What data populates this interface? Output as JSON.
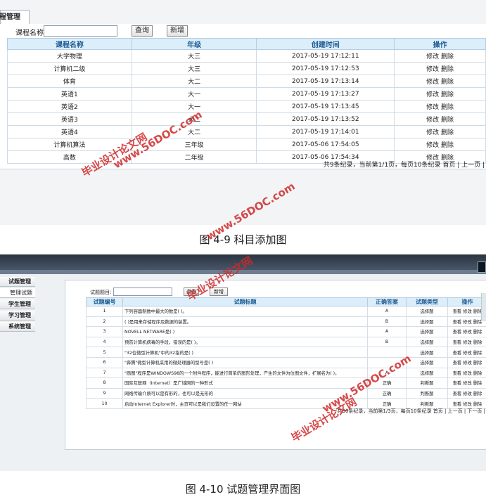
{
  "figure1": {
    "tab_label": "程管理",
    "search_label": "课程名称:",
    "search_value": "",
    "query_button": "查询",
    "add_button": "新增",
    "columns": [
      "课程名称",
      "年级",
      "创建时间",
      "操作"
    ],
    "rows": [
      {
        "name": "大学物理",
        "grade": "大三",
        "created": "2017-05-19 17:12:11"
      },
      {
        "name": "计算机二级",
        "grade": "大三",
        "created": "2017-05-19 17:12:53"
      },
      {
        "name": "体育",
        "grade": "大二",
        "created": "2017-05-19 17:13:14"
      },
      {
        "name": "英语1",
        "grade": "大一",
        "created": "2017-05-19 17:13:27"
      },
      {
        "name": "英语2",
        "grade": "大一",
        "created": "2017-05-19 17:13:45"
      },
      {
        "name": "英语3",
        "grade": "大二",
        "created": "2017-05-19 17:13:52"
      },
      {
        "name": "英语4",
        "grade": "大二",
        "created": "2017-05-19 17:14:01"
      },
      {
        "name": "计算机算法",
        "grade": "三年级",
        "created": "2017-05-06 17:54:05"
      },
      {
        "name": "高数",
        "grade": "二年级",
        "created": "2017-05-06 17:54:34"
      }
    ],
    "edit_label": "修改",
    "delete_label": "删除",
    "pager": "共9条纪录，当前第1/1页，每页10条纪录 首页 | 上一页 |"
  },
  "caption1": "图 4-9 科目添加图",
  "figure2": {
    "sidebar": [
      {
        "label": "试题管理",
        "sub": false
      },
      {
        "label": "管理试题",
        "sub": true
      },
      {
        "label": "学生管理",
        "sub": false
      },
      {
        "label": "学习管理",
        "sub": false
      },
      {
        "label": "系统管理",
        "sub": false
      }
    ],
    "tab_label": "试题管理",
    "search_label": "试题题目:",
    "query_button": "查询",
    "add_button": "新增",
    "columns": [
      "试题编号",
      "试题标题",
      "正确答案",
      "试题类型",
      "操作"
    ],
    "rows": [
      {
        "no": "1",
        "title": "下列容器制数中最大的数是(   )。",
        "answer": "A",
        "type": "选择题"
      },
      {
        "no": "2",
        "title": "(   )是用来存储程序及数据的装置。",
        "answer": "B",
        "type": "选择题"
      },
      {
        "no": "3",
        "title": "NOVELL NETWARE是(   )",
        "answer": "A",
        "type": "选择题"
      },
      {
        "no": "4",
        "title": "预防计算机病毒的手段，错误的是(   )。",
        "answer": "B",
        "type": "选择题"
      },
      {
        "no": "5",
        "title": "\"32位微型计算机\"中的32指的是(   )",
        "answer": "",
        "type": "选择题"
      },
      {
        "no": "6",
        "title": "\"奔腾\"微型计算机采用的微处理器的型号是(   )",
        "answer": "",
        "type": "选择题"
      },
      {
        "no": "7",
        "title": "\"画图\"程序是WINDOWS98的一个附件程序，能进行简单的图形处理，产生的文件为位图文件，扩展名为(   )。",
        "answer": "A",
        "type": "选择题"
      },
      {
        "no": "8",
        "title": "国际互联网（Internet）是广域网的一种形式",
        "answer": "正确",
        "type": "判断题"
      },
      {
        "no": "9",
        "title": "网络传输介质可以是有形的，也可以是无形的",
        "answer": "正确",
        "type": "判断题"
      },
      {
        "no": "10",
        "title": "启动Internet Explorer时，主页可以是我们设置的任一网站",
        "answer": "正确",
        "type": "判断题"
      }
    ],
    "view_label": "查看",
    "edit_label": "修改",
    "delete_label": "删除",
    "pager": "共30条纪录，当前第1/3页，每页10条纪录 首页 | 上一页 | 下一页 |"
  },
  "caption2": "图 4-10 试题管理界面图",
  "watermarks": {
    "text1": "毕业设计论文网",
    "text2": "www.56DOC.com"
  }
}
